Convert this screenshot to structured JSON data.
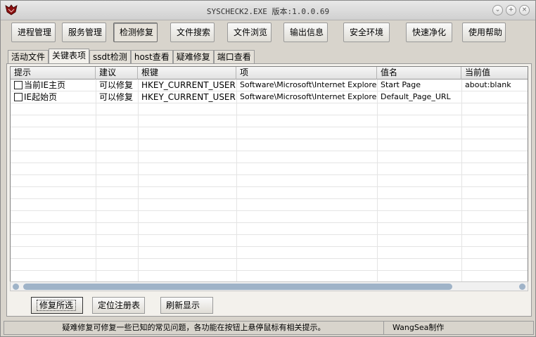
{
  "window": {
    "title": "SYSCHECK2.EXE  版本:1.0.0.69"
  },
  "toolbar": [
    {
      "label": "进程管理"
    },
    {
      "label": "服务管理"
    },
    {
      "label": "检测修复",
      "active": true
    },
    {
      "label": "文件搜索"
    },
    {
      "label": "文件浏览"
    },
    {
      "label": "输出信息"
    },
    {
      "label": "安全环境"
    },
    {
      "label": "快速净化"
    },
    {
      "label": "使用帮助"
    }
  ],
  "tabs": [
    {
      "label": "活动文件"
    },
    {
      "label": "关键表项",
      "active": true
    },
    {
      "label": "ssdt检测"
    },
    {
      "label": "host查看"
    },
    {
      "label": "疑难修复"
    },
    {
      "label": "端口查看"
    }
  ],
  "grid": {
    "columns": [
      "提示",
      "建议",
      "根键",
      "项",
      "值名",
      "当前值"
    ],
    "rows": [
      {
        "checked": false,
        "cells": [
          "当前IE主页",
          "可以修复",
          "HKEY_CURRENT_USER",
          "Software\\Microsoft\\Internet Explorer\\...",
          "Start Page",
          "about:blank"
        ]
      },
      {
        "checked": false,
        "cells": [
          "IE起始页",
          "可以修复",
          "HKEY_CURRENT_USER",
          "Software\\Microsoft\\Internet Explorer\\...",
          "Default_Page_URL",
          ""
        ]
      }
    ]
  },
  "actions": [
    {
      "label": "修复所选",
      "default": true
    },
    {
      "label": "定位注册表"
    },
    {
      "label": "刷新显示"
    }
  ],
  "status": {
    "message": "疑难修复可修复一些已知的常见问题，各功能在按钮上悬停鼠标有相关提示。",
    "author": "WangSea制作"
  }
}
